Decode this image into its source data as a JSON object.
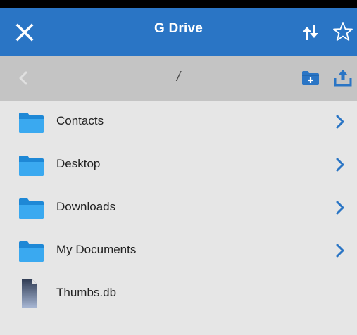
{
  "app_bar": {
    "title": "G Drive",
    "background_color": "#2a75c5",
    "left_icon": "close-icon",
    "right_icons": [
      "sync-icon",
      "star-outline-icon"
    ]
  },
  "path_bar": {
    "path": "/",
    "background_color": "#c4c4c4",
    "icons": [
      "back-chevron-icon",
      "new-folder-icon",
      "upload-icon"
    ]
  },
  "items": [
    {
      "name": "Contacts",
      "type": "folder"
    },
    {
      "name": "Desktop",
      "type": "folder"
    },
    {
      "name": "Downloads",
      "type": "folder"
    },
    {
      "name": "My Documents",
      "type": "folder"
    },
    {
      "name": "Thumbs.db",
      "type": "file"
    }
  ],
  "colors": {
    "accent": "#2a75c5",
    "folder": "#2e9fe8",
    "list_background": "#e6e6e6"
  }
}
